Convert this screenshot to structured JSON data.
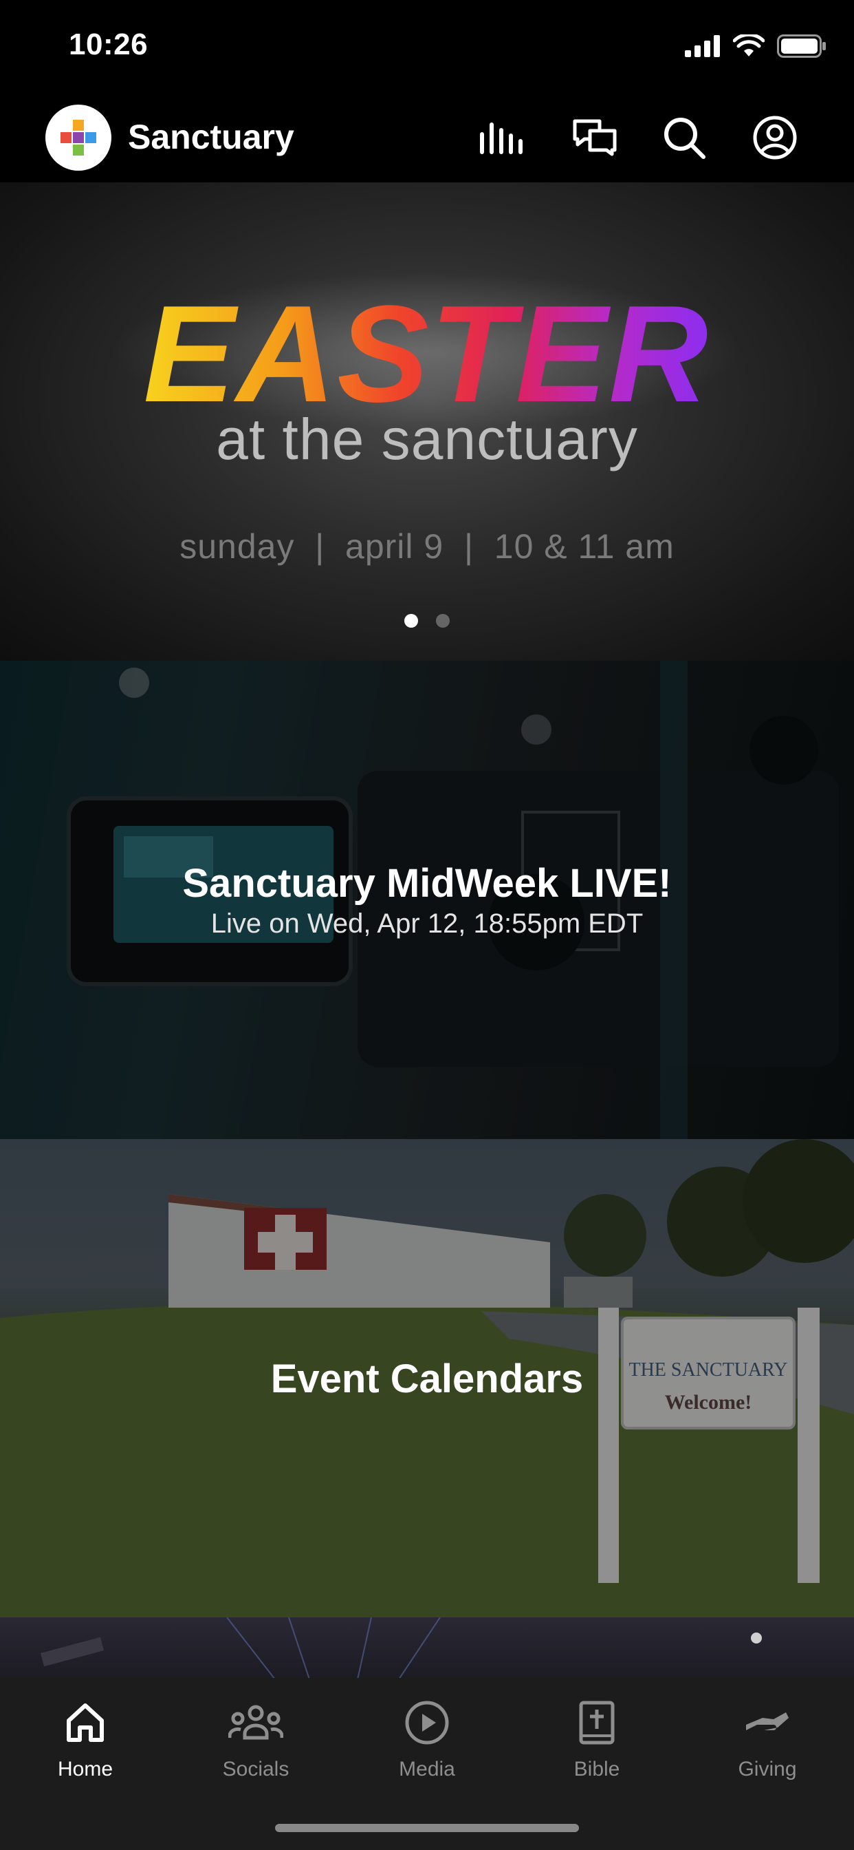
{
  "status_bar": {
    "time": "10:26"
  },
  "header": {
    "app_title": "Sanctuary",
    "icons": [
      "equalizer-icon",
      "chat-icon",
      "search-icon",
      "profile-icon"
    ]
  },
  "hero": {
    "headline": "EASTER",
    "subtitle": "at the sanctuary",
    "date_line": "sunday  |  april 9  |  10 & 11 am",
    "carousel_count": 2,
    "carousel_active": 1
  },
  "cards": {
    "live": {
      "title": "Sanctuary MidWeek LIVE!",
      "subtitle": "Live on Wed, Apr 12, 18:55pm EDT"
    },
    "events": {
      "title": "Event Calendars",
      "sign_line1": "THE SANCTUARY",
      "sign_line2": "Welcome!"
    }
  },
  "tabs": [
    {
      "label": "Home",
      "icon": "home-icon",
      "active": true
    },
    {
      "label": "Socials",
      "icon": "people-icon",
      "active": false
    },
    {
      "label": "Media",
      "icon": "play-circle-icon",
      "active": false
    },
    {
      "label": "Bible",
      "icon": "bible-icon",
      "active": false
    },
    {
      "label": "Giving",
      "icon": "giving-hand-icon",
      "active": false
    }
  ],
  "colors": {
    "background": "#000000",
    "tab_bar": "#1c1c1c",
    "tab_inactive": "#8e8e8e",
    "tab_active": "#ffffff"
  }
}
